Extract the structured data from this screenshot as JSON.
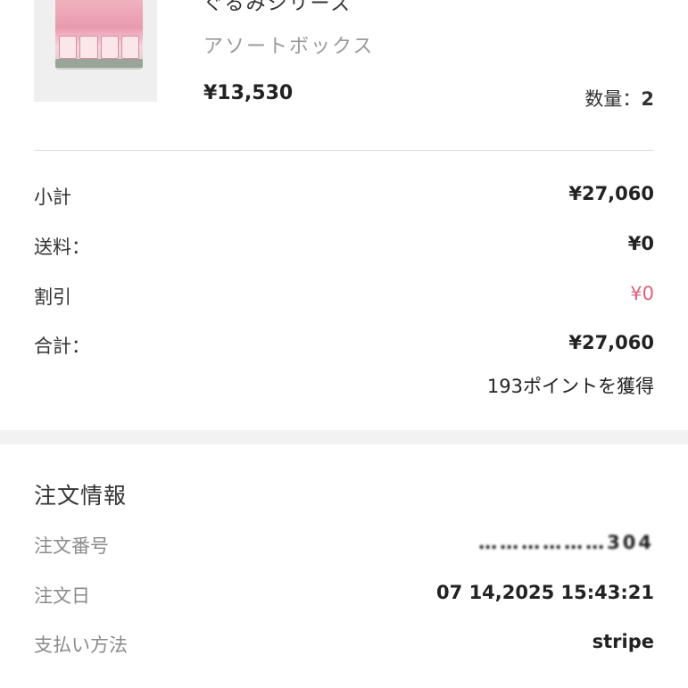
{
  "product": {
    "series_name": "ぐるみシリーズ",
    "variant": "アソートボックス",
    "unit_price": "¥13,530",
    "quantity_label": "数量：",
    "quantity_value": "2"
  },
  "summary": {
    "subtotal_label": "小計",
    "subtotal_value": "¥27,060",
    "shipping_label": "送料：",
    "shipping_value": "¥0",
    "discount_label": "割引",
    "discount_value": "¥0",
    "total_label": "合計：",
    "total_value": "¥27,060",
    "points_text": "193ポイントを獲得",
    "discount_color": "#e0607a"
  },
  "order_info": {
    "title": "注文情報",
    "order_number_label": "注文番号",
    "order_number_value": "………………304",
    "order_date_label": "注文日",
    "order_date_value": "07 14,2025 15:43:21",
    "payment_method_label": "支払い方法",
    "payment_method_value": "stripe"
  }
}
